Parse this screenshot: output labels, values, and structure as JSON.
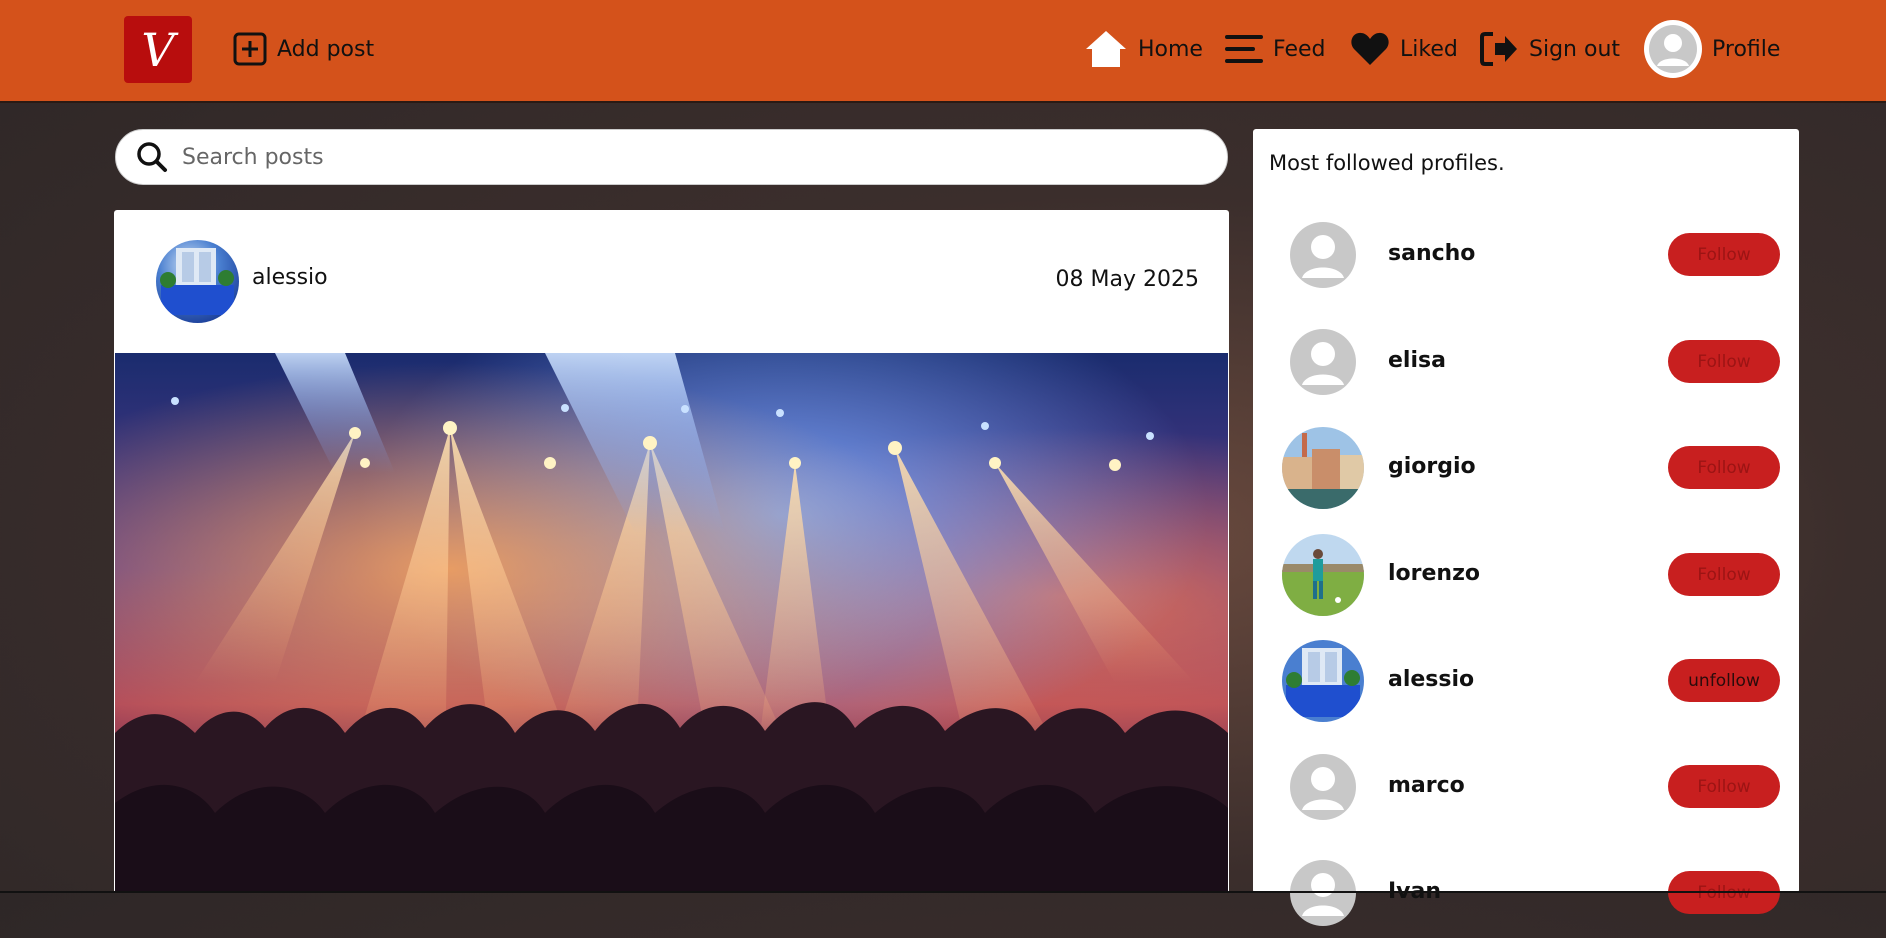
{
  "header": {
    "logo_letter": "V",
    "add_post_label": "Add post",
    "nav": [
      {
        "label": "Home",
        "icon": "home-icon"
      },
      {
        "label": "Feed",
        "icon": "feed-icon"
      },
      {
        "label": "Liked",
        "icon": "heart-icon"
      },
      {
        "label": "Sign out",
        "icon": "sign-out-icon"
      },
      {
        "label": "Profile",
        "icon": "profile-avatar-icon"
      }
    ]
  },
  "search": {
    "placeholder": "Search posts"
  },
  "post": {
    "author": "alessio",
    "date": "08 May 2025"
  },
  "sidebar": {
    "title": "Most followed profiles.",
    "profiles": [
      {
        "name": "sancho",
        "button": "Follow",
        "avatar": "default"
      },
      {
        "name": "elisa",
        "button": "Follow",
        "avatar": "default"
      },
      {
        "name": "giorgio",
        "button": "Follow",
        "avatar": "photo-venice"
      },
      {
        "name": "lorenzo",
        "button": "Follow",
        "avatar": "photo-football"
      },
      {
        "name": "alessio",
        "button": "unfollow",
        "avatar": "photo-blue"
      },
      {
        "name": "marco",
        "button": "Follow",
        "avatar": "default"
      },
      {
        "name": "Ivan",
        "button": "Follow",
        "avatar": "default"
      }
    ]
  },
  "colors": {
    "header": "#d4521b",
    "logo": "#b80d0d",
    "button": "#c81f1f"
  }
}
